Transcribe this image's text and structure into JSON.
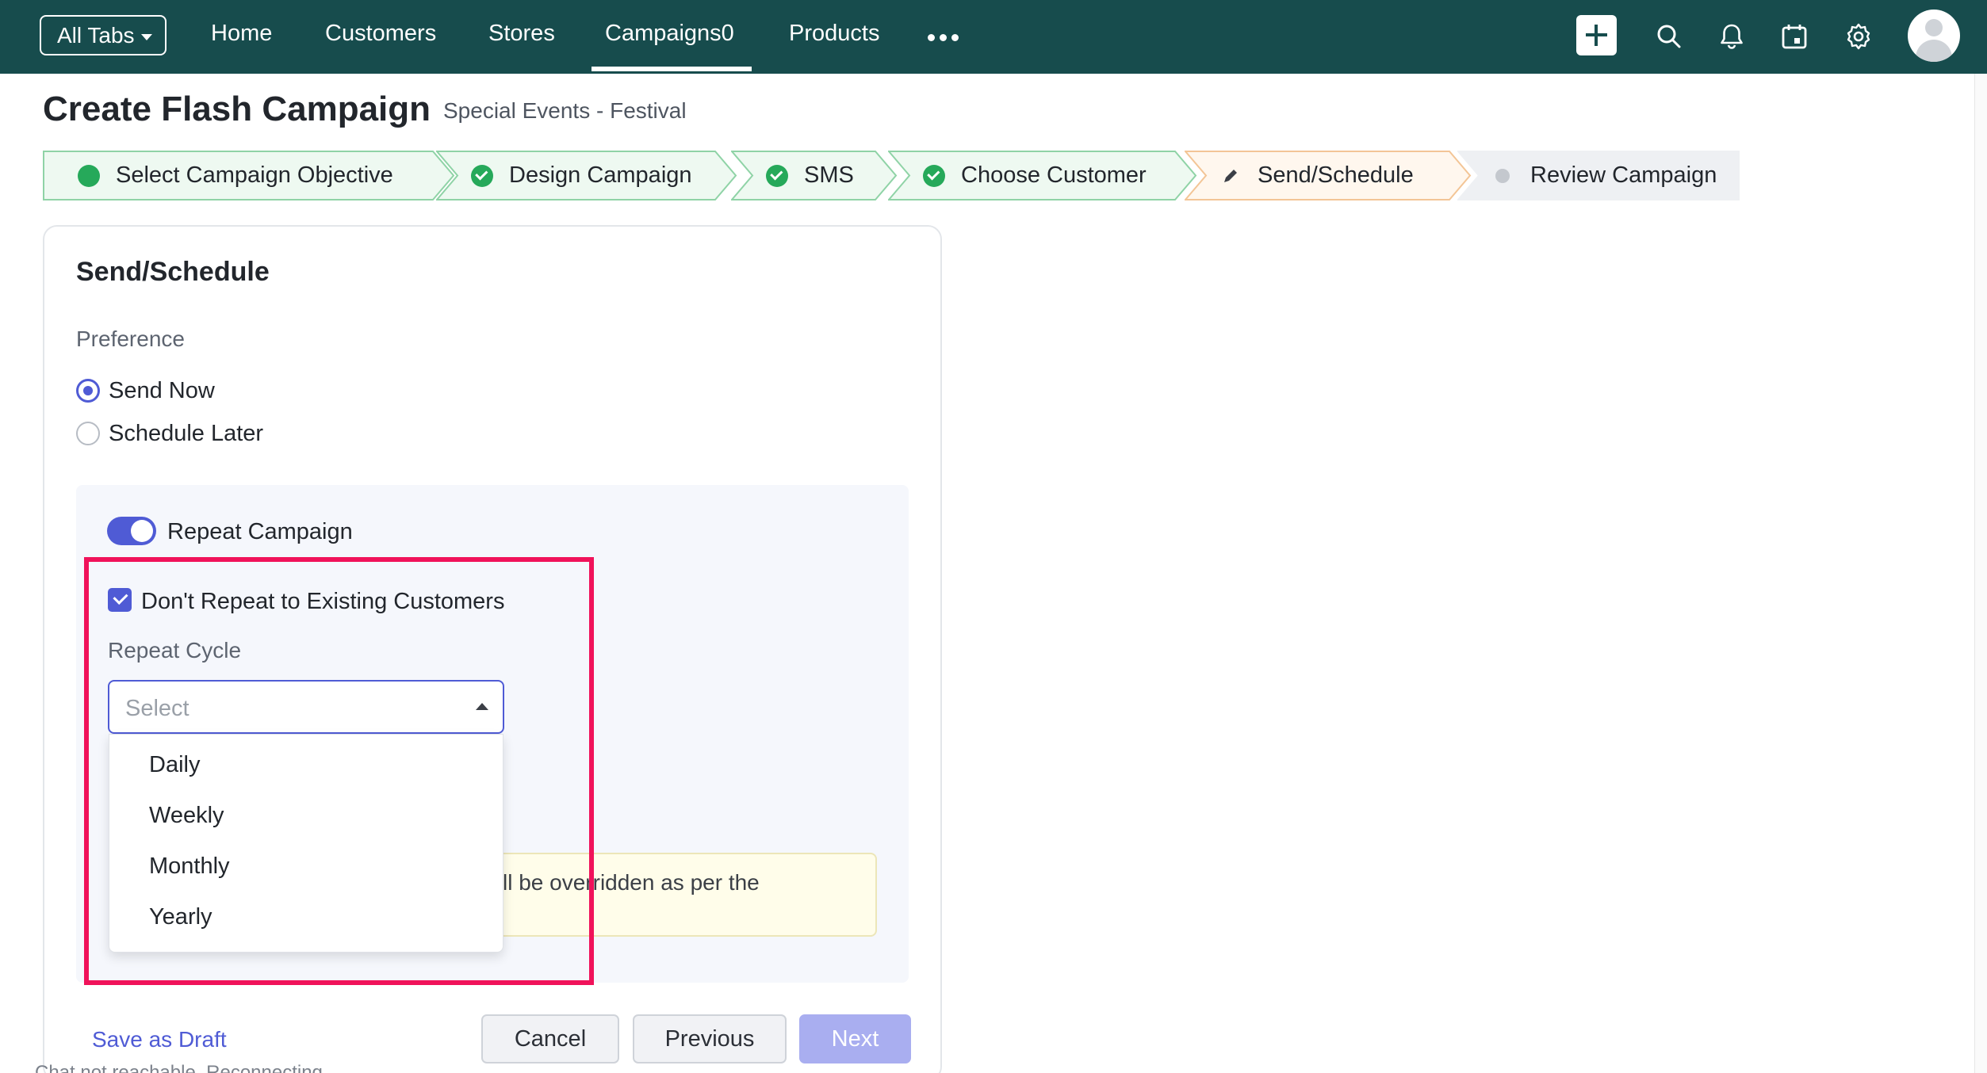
{
  "nav": {
    "all_tabs": "All Tabs",
    "items": [
      "Home",
      "Customers",
      "Stores",
      "Campaigns0",
      "Products"
    ],
    "active": "Campaigns0",
    "icons": [
      "add-icon",
      "search-icon",
      "bell-icon",
      "calendar-icon",
      "gear-icon",
      "avatar"
    ]
  },
  "header": {
    "title": "Create Flash Campaign",
    "subtitle": "Special Events - Festival"
  },
  "steps": [
    {
      "label": "Select Campaign Objective",
      "state": "done"
    },
    {
      "label": "Design Campaign",
      "state": "done"
    },
    {
      "label": "SMS",
      "state": "done"
    },
    {
      "label": "Choose Customer",
      "state": "done"
    },
    {
      "label": "Send/Schedule",
      "state": "current"
    },
    {
      "label": "Review Campaign",
      "state": "pending"
    }
  ],
  "card": {
    "title": "Send/Schedule",
    "preference_label": "Preference",
    "options": [
      "Send Now",
      "Schedule Later"
    ],
    "selected": "Send Now",
    "repeat_toggle_label": "Repeat Campaign",
    "repeat_toggle_on": true,
    "dont_repeat_label": "Don't Repeat to Existing Customers",
    "dont_repeat_checked": true,
    "repeat_cycle_label": "Repeat Cycle",
    "repeat_cycle_placeholder": "Select",
    "repeat_cycle_options": [
      "Daily",
      "Weekly",
      "Monthly",
      "Yearly"
    ],
    "note_text": "ll be overridden as per the"
  },
  "footer": {
    "save_draft": "Save as Draft",
    "cancel": "Cancel",
    "previous": "Previous",
    "next": "Next",
    "status": "Chat not reachable. Reconnecting..."
  },
  "colors": {
    "topbar": "#174c4d",
    "accent": "#4f5bd5",
    "success": "#26a95a",
    "highlight": "#f0125a",
    "current_step": "#fff7ee"
  }
}
